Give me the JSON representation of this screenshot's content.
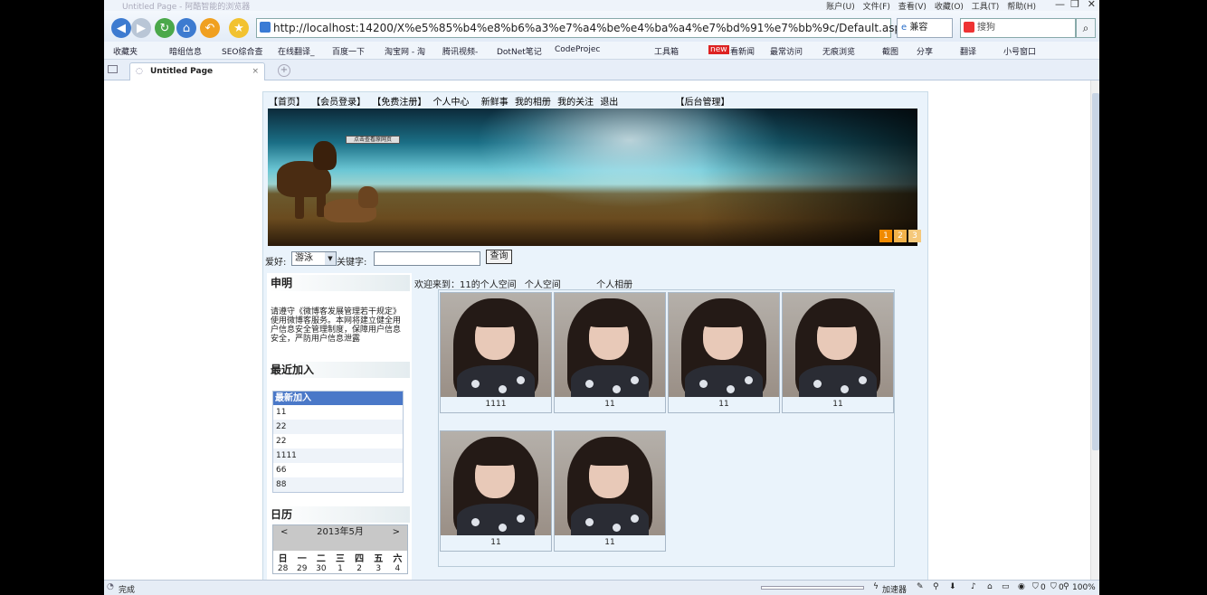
{
  "browser": {
    "title": "Untitled Page - 阿酷智能的浏览器",
    "menus": [
      "账户(U)",
      "文件(F)",
      "查看(V)",
      "收藏(O)",
      "工具(T)",
      "帮助(H)"
    ],
    "url": "http://localhost:14200/X%e5%85%b4%e8%b6%a3%e7%a4%be%e4%ba%a4%e7%bd%91%e7%bb%9c/Default.aspx",
    "compat_label": "兼容",
    "search_placeholder": "搜狗",
    "favorites": [
      "收藏夹",
      "暗组信息",
      "SEO综合查",
      "在线翻译_",
      "百度一下",
      "淘宝网 - 淘",
      "腾讯视频-",
      "DotNet笔记",
      "CodeProjec",
      "工具箱",
      "看新闻",
      "最常访问",
      "无痕浏览",
      "截图",
      "分享",
      "翻译",
      "小号窗口"
    ],
    "new_badge": "new",
    "tab_title": "Untitled Page",
    "status_text": "完成",
    "status_right": [
      "加速器",
      "0",
      "0",
      "100%"
    ]
  },
  "page": {
    "nav": [
      "【首页】",
      "【会员登录】",
      "【免费注册】",
      "个人中心",
      "新鲜事",
      "我的相册",
      "我的关注",
      "退出",
      "【后台管理】"
    ],
    "banner_button": "点击查看原网页",
    "banner_pages": [
      "1",
      "2",
      "3"
    ],
    "search": {
      "hobby_label": "爱好:",
      "hobby_value": "游泳",
      "keyword_label": "关键字:",
      "query_button": "查询"
    },
    "sidebar": {
      "notice_title": "申明",
      "notice_text": "请遵守《微博客发展管理若干规定》使用微博客服务。本网将建立健全用户信息安全管理制度，保障用户信息安全，严防用户信息泄露",
      "recent_title": "最近加入",
      "recent_header": "最新加入",
      "recent_items": [
        "11",
        "22",
        "22",
        "1111",
        "66",
        "88"
      ],
      "calendar_title": "日历",
      "calendar_month": "2013年5月",
      "calendar_prev": "<",
      "calendar_next": ">",
      "weekdays": [
        "日",
        "一",
        "二",
        "三",
        "四",
        "五",
        "六"
      ],
      "first_week": [
        "28",
        "29",
        "30",
        "1",
        "2",
        "3",
        "4"
      ]
    },
    "main": {
      "welcome": "欢迎来到：11的个人空间",
      "links": [
        "个人空间",
        "个人相册"
      ],
      "photos": [
        "1111",
        "11",
        "11",
        "11",
        "11",
        "11"
      ]
    }
  }
}
